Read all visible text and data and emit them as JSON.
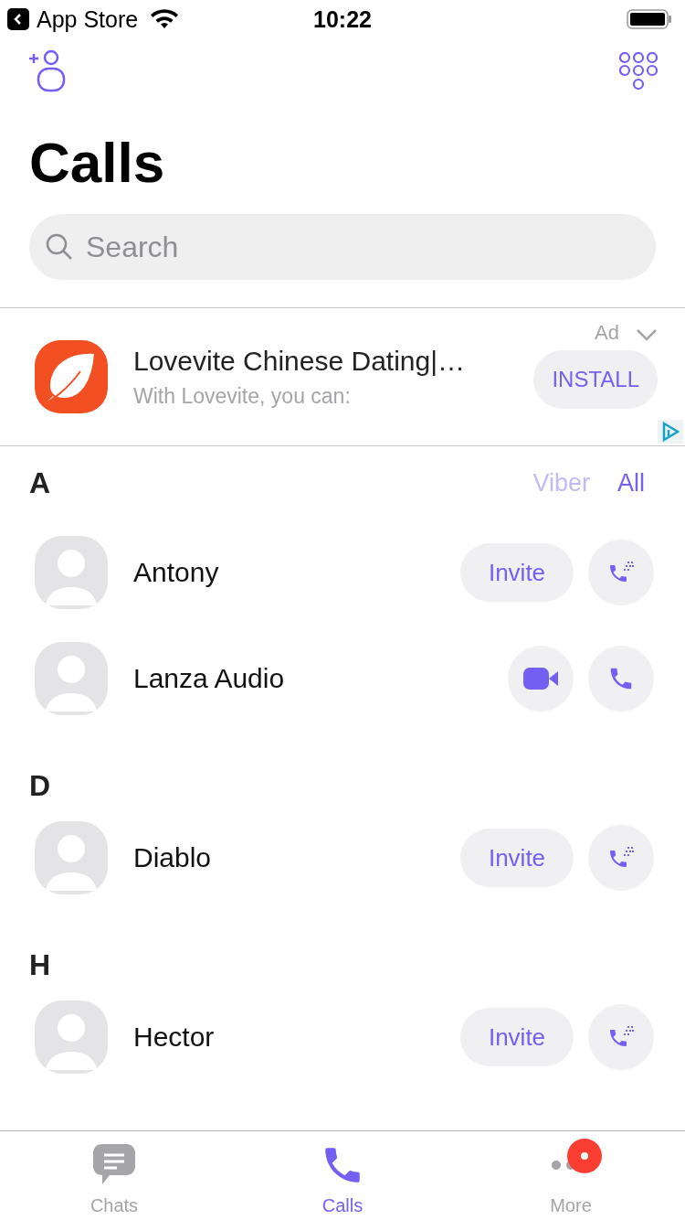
{
  "status_bar": {
    "back_label": "App Store",
    "time": "10:22"
  },
  "title": "Calls",
  "search": {
    "placeholder": "Search"
  },
  "ad": {
    "label": "Ad",
    "title": "Lovevite Chinese Dating|…",
    "subtitle": "With Lovevite, you can:",
    "button": "INSTALL"
  },
  "filters": [
    {
      "label": "Viber",
      "selected": false
    },
    {
      "label": "All",
      "selected": true
    }
  ],
  "sections": [
    {
      "letter": "A",
      "contacts": [
        {
          "name": "Antony",
          "kind": "invite",
          "invite": "Invite"
        },
        {
          "name": "Lanza Audio",
          "kind": "viber"
        }
      ]
    },
    {
      "letter": "D",
      "contacts": [
        {
          "name": "Diablo",
          "kind": "invite",
          "invite": "Invite"
        }
      ]
    },
    {
      "letter": "H",
      "contacts": [
        {
          "name": "Hector",
          "kind": "invite",
          "invite": "Invite"
        }
      ]
    }
  ],
  "tabs": [
    {
      "label": "Chats",
      "selected": false,
      "kind": "chats"
    },
    {
      "label": "Calls",
      "selected": true,
      "kind": "calls"
    },
    {
      "label": "More",
      "selected": false,
      "kind": "more",
      "badge": true
    }
  ]
}
